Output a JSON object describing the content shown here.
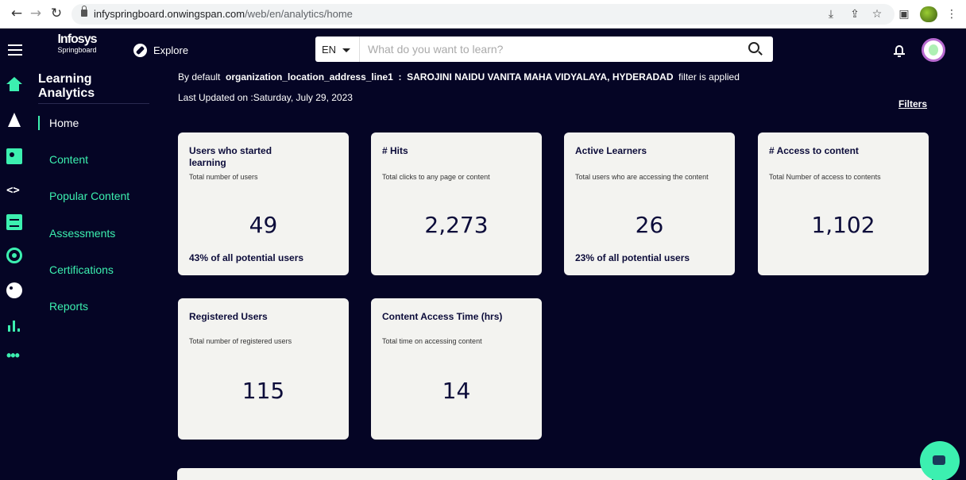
{
  "browser": {
    "url_host": "infyspringboard.onwingspan.com",
    "url_path": "/web/en/analytics/home"
  },
  "header": {
    "logo_line1": "Infosys",
    "logo_line2": "Springboard",
    "explore_label": "Explore",
    "language": "EN",
    "search_placeholder": "What do you want to learn?"
  },
  "sidebar": {
    "title": "Learning Analytics",
    "items": [
      {
        "label": "Home"
      },
      {
        "label": "Content"
      },
      {
        "label": "Popular Content"
      },
      {
        "label": "Assessments"
      },
      {
        "label": "Certifications"
      },
      {
        "label": "Reports"
      }
    ]
  },
  "main": {
    "default_prefix": "By default",
    "default_field": "organization_location_address_line1",
    "default_sep": ":",
    "default_value": "SAROJINI NAIDU VANITA MAHA VIDYALAYA, HYDERADAD",
    "default_suffix": "filter is applied",
    "last_updated": "Last Updated on :Saturday, July 29, 2023",
    "filters_label": "Filters"
  },
  "cards": [
    {
      "title": "Users who started learning",
      "desc": "Total number of users",
      "value": "49",
      "foot": "43%  of all potential users"
    },
    {
      "title": "# Hits",
      "desc": "Total clicks to any page or content",
      "value": "2,273",
      "foot": ""
    },
    {
      "title": "Active Learners",
      "desc": "Total users who are accessing the content",
      "value": "26",
      "foot": "23%  of all potential users"
    },
    {
      "title": "# Access to content",
      "desc": "Total Number of access to contents",
      "value": "1,102",
      "foot": ""
    },
    {
      "title": "Registered Users",
      "desc": "Total number of registered users",
      "value": "115",
      "foot": ""
    },
    {
      "title": "Content Access Time (hrs)",
      "desc": "Total time on accessing content",
      "value": "14",
      "foot": ""
    }
  ],
  "colors": {
    "background": "#050525",
    "accent": "#3cf0b0",
    "card": "#f3f3f0",
    "text_dark": "#0c0c3a"
  }
}
